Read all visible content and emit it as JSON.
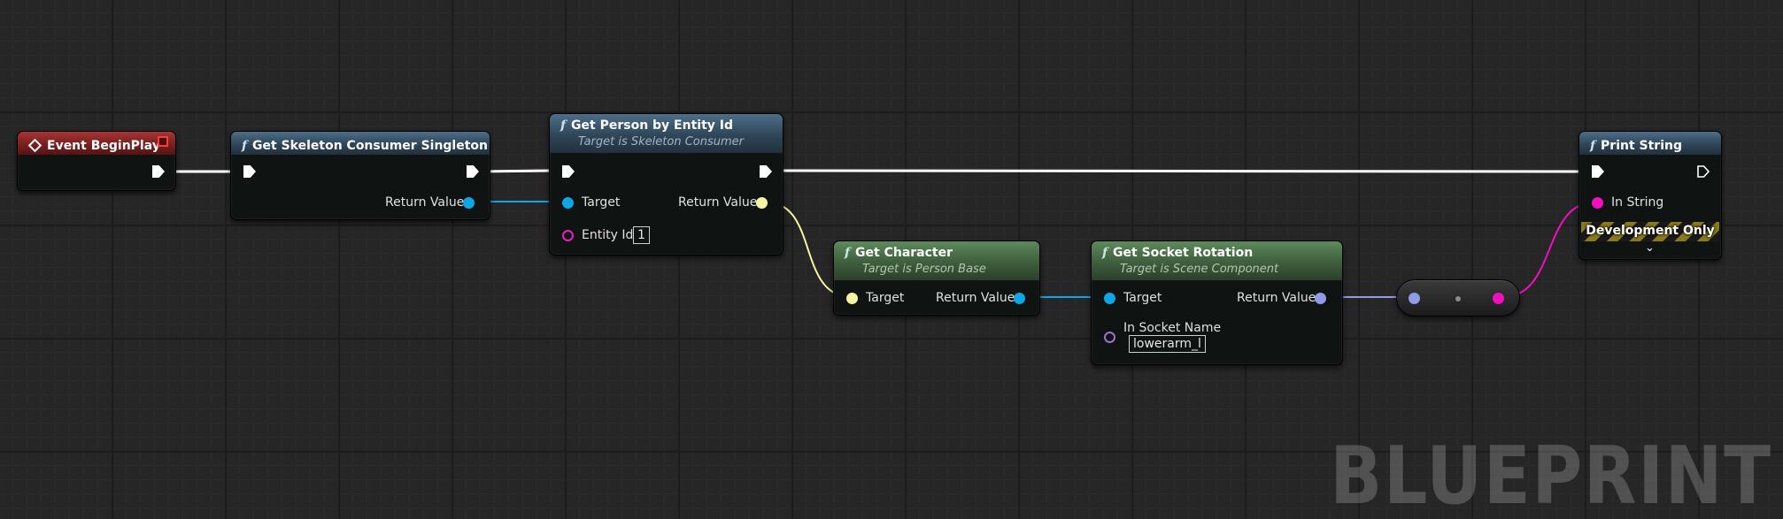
{
  "graph": {
    "watermark": "BLUEPRINT",
    "colors": {
      "background": "#262626",
      "event_header": "#772020",
      "function_header": "#2f4659",
      "pure_function_header": "#3e5e3d",
      "exec_wire": "#ffffff",
      "object_wire": "#0ea6e6",
      "struct_wire": "#f3f5a0",
      "rotator_wire": "#8f9be6",
      "string_wire": "#f20fbd"
    }
  },
  "nodes": {
    "event_begin_play": {
      "title": "Event BeginPlay",
      "icon": "event-diamond-icon"
    },
    "get_skeleton_consumer": {
      "title": "Get Skeleton Consumer Singleton",
      "icon": "function-icon",
      "return_label": "Return Value"
    },
    "get_person_by_entity": {
      "title": "Get Person by Entity Id",
      "subtitle": "Target is Skeleton Consumer",
      "icon": "function-icon",
      "target_label": "Target",
      "return_label": "Return Value",
      "entity_label": "Entity Id",
      "entity_value": "1"
    },
    "get_character": {
      "title": "Get Character",
      "subtitle": "Target is Person Base",
      "icon": "function-icon",
      "target_label": "Target",
      "return_label": "Return Value"
    },
    "get_socket_rotation": {
      "title": "Get Socket Rotation",
      "subtitle": "Target is Scene Component",
      "icon": "function-icon",
      "target_label": "Target",
      "return_label": "Return Value",
      "socket_label": "In Socket Name",
      "socket_value": "lowerarm_l"
    },
    "print_string": {
      "title": "Print String",
      "icon": "function-icon",
      "in_string_label": "In String",
      "dev_only_label": "Development Only",
      "expand_icon": "chevron-down-icon"
    }
  }
}
